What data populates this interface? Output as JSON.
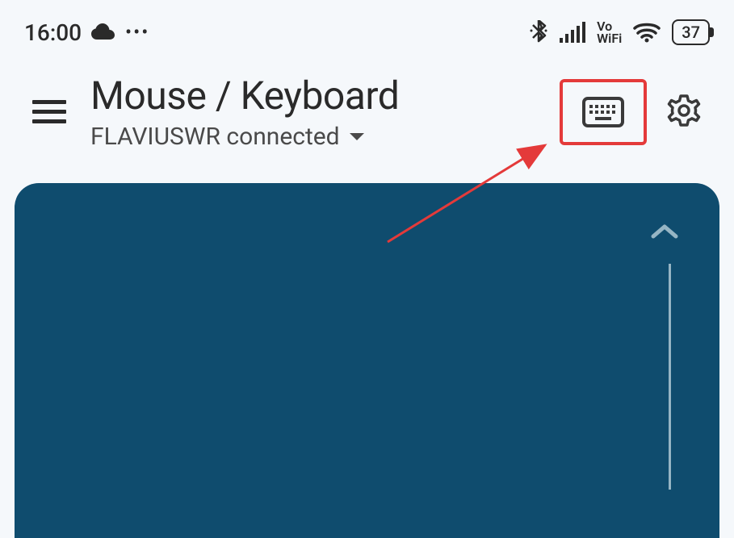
{
  "status": {
    "time": "16:00",
    "battery": "37",
    "vo": "Vo",
    "wifi": "WiFi"
  },
  "header": {
    "title": "Mouse / Keyboard",
    "subtitle": "FLAVIUSWR connected"
  }
}
